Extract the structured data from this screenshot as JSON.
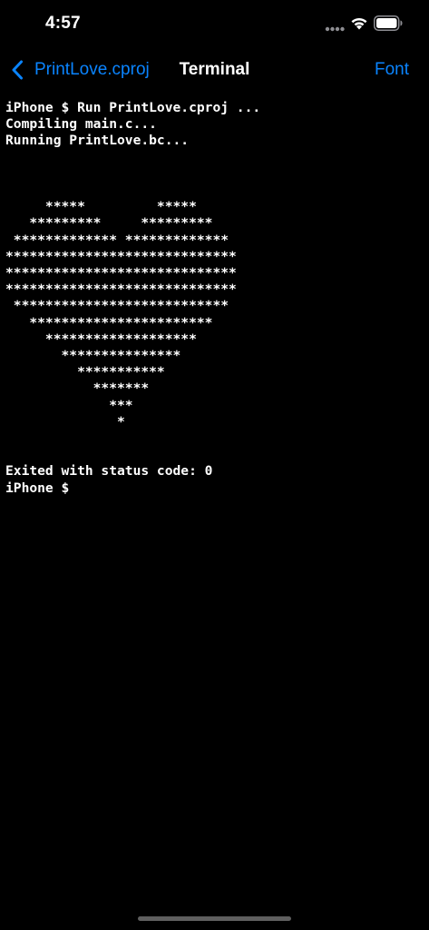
{
  "status_bar": {
    "time": "4:57"
  },
  "nav": {
    "back_label": "PrintLove.cproj",
    "title": "Terminal",
    "font_label": "Font"
  },
  "terminal": {
    "lines": [
      "iPhone $ Run PrintLove.cproj ...",
      "Compiling main.c...",
      "Running PrintLove.bc...",
      "",
      "",
      "",
      "     *****         *****",
      "   *********     *********",
      " ************* *************",
      "*****************************",
      "*****************************",
      "*****************************",
      " ***************************",
      "   ***********************",
      "     *******************",
      "       ***************",
      "         ***********",
      "           *******",
      "             ***",
      "              *",
      "",
      "",
      "Exited with status code: 0",
      "iPhone $"
    ]
  },
  "colors": {
    "background": "#000000",
    "text": "#ffffff",
    "accent": "#0a84ff"
  }
}
